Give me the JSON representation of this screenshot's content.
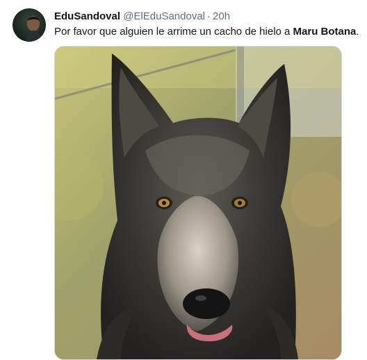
{
  "tweet": {
    "author_name": "EduSandoval",
    "author_handle": "@ElEduSandoval",
    "separator": "·",
    "time": "20h",
    "text_before": "Por favor que alguien le arrime un cacho de hielo a ",
    "text_bold": "Maru Botana",
    "text_after": "."
  },
  "icons": {
    "avatar": "profile-avatar",
    "media": "wolf-photo"
  }
}
